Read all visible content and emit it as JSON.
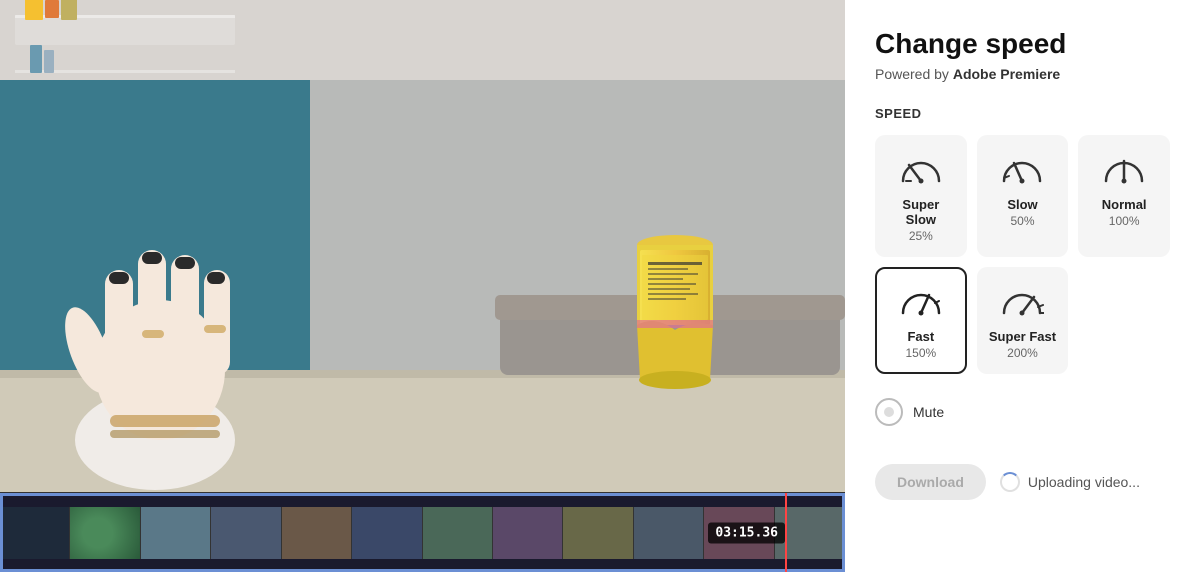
{
  "panel": {
    "title": "Change speed",
    "subtitle_prefix": "Powered by ",
    "subtitle_brand": "Adobe Premiere"
  },
  "speed_section": {
    "label": "Speed",
    "options": [
      {
        "id": "super-slow",
        "name": "Super Slow",
        "pct": "25%",
        "icon": "super-slow"
      },
      {
        "id": "slow",
        "name": "Slow",
        "pct": "50%",
        "icon": "slow"
      },
      {
        "id": "normal",
        "name": "Normal",
        "pct": "100%",
        "icon": "normal"
      },
      {
        "id": "fast",
        "name": "Fast",
        "pct": "150%",
        "icon": "fast",
        "selected": true
      },
      {
        "id": "super-fast",
        "name": "Super Fast",
        "pct": "200%",
        "icon": "super-fast"
      }
    ]
  },
  "mute": {
    "label": "Mute"
  },
  "actions": {
    "download_label": "Download",
    "uploading_label": "Uploading video..."
  },
  "timeline": {
    "timecode": "03:15.36"
  }
}
